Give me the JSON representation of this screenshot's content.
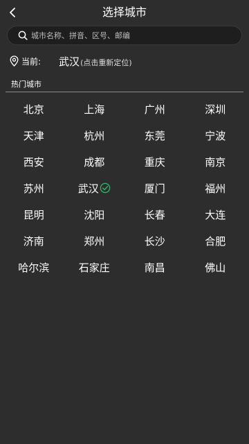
{
  "header": {
    "title": "选择城市"
  },
  "search": {
    "placeholder": "城市名称、拼音、区号、邮编"
  },
  "location": {
    "label": "当前:",
    "city": "武汉",
    "relocate_hint": "(点击重新定位)"
  },
  "hot_cities": {
    "title": "热门城市",
    "selected": "武汉",
    "cities": [
      "北京",
      "上海",
      "广州",
      "深圳",
      "天津",
      "杭州",
      "东莞",
      "宁波",
      "西安",
      "成都",
      "重庆",
      "南京",
      "苏州",
      "武汉",
      "厦门",
      "福州",
      "昆明",
      "沈阳",
      "长春",
      "大连",
      "济南",
      "郑州",
      "长沙",
      "合肥",
      "哈尔滨",
      "石家庄",
      "南昌",
      "佛山"
    ]
  },
  "colors": {
    "background": "#2d2d2d",
    "search_bg": "#1e1e1e",
    "accent_green": "#2fb36a",
    "divider": "#8a8a8a"
  },
  "icons": {
    "back": "chevron-left-icon",
    "search": "search-icon",
    "location": "location-pin-icon",
    "selected": "check-circle-icon"
  }
}
